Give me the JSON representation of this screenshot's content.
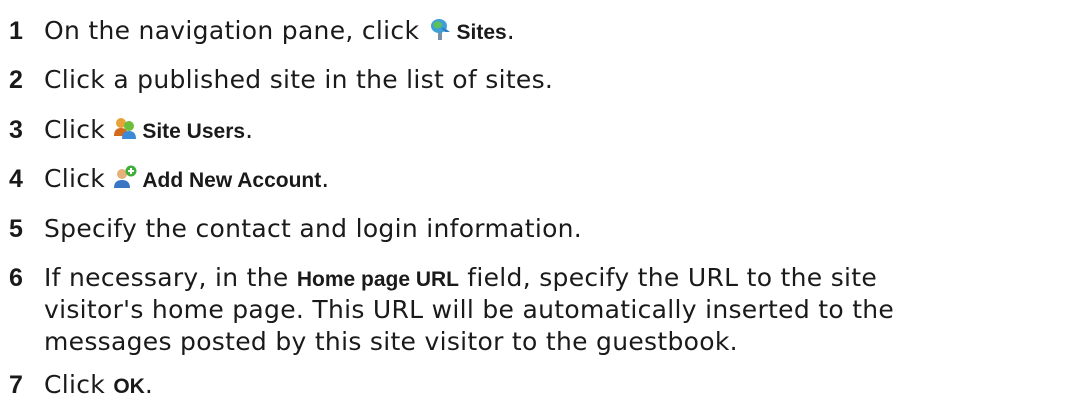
{
  "steps": [
    {
      "number": "1",
      "before": "On the navigation pane, click ",
      "icon": "sites-icon",
      "ui_label": "Sites",
      "after": "."
    },
    {
      "number": "2",
      "text": "Click a published site in the list of sites."
    },
    {
      "number": "3",
      "before": "Click ",
      "icon": "site-users-icon",
      "ui_label": "Site Users",
      "after": "."
    },
    {
      "number": "4",
      "before": "Click ",
      "icon": "add-account-icon",
      "ui_label": "Add New Account",
      "after": "."
    },
    {
      "number": "5",
      "text": "Specify the contact and login information."
    },
    {
      "number": "6",
      "before": "If necessary, in the ",
      "ui_label": "Home page URL",
      "after": " field, specify the URL to the site",
      "line2": "visitor's home page. This URL will be automatically inserted to the",
      "line3": "messages posted by this site visitor to the guestbook."
    },
    {
      "number": "7",
      "before": "Click ",
      "ui_label": "OK",
      "after": "."
    }
  ]
}
